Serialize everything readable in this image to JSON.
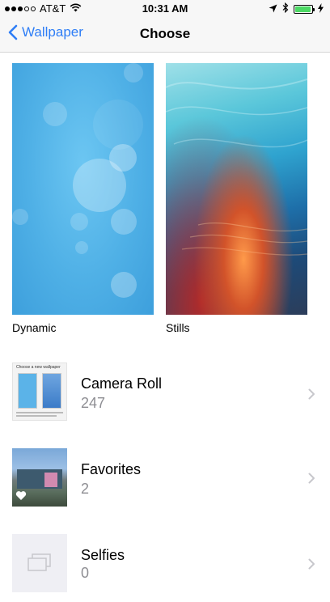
{
  "status_bar": {
    "carrier": "AT&T",
    "time": "10:31 AM",
    "signal_strength": 3,
    "signal_max": 5,
    "battery_level": 0.9,
    "battery_color": "#4cd964"
  },
  "nav": {
    "back_label": "Wallpaper",
    "title": "Choose",
    "accent_color": "#2f7ef6"
  },
  "categories": [
    {
      "label": "Dynamic"
    },
    {
      "label": "Stills"
    }
  ],
  "albums": [
    {
      "name": "Camera Roll",
      "count": "247"
    },
    {
      "name": "Favorites",
      "count": "2"
    },
    {
      "name": "Selfies",
      "count": "0"
    }
  ],
  "camera_thumb_text": "Choose a new wallpaper",
  "icons": {
    "back": "chevron-left-icon",
    "location": "location-arrow-icon",
    "bluetooth": "bluetooth-icon",
    "charging": "bolt-icon",
    "wifi": "wifi-icon",
    "row_disclosure": "chevron-right-icon",
    "favorite": "heart-icon",
    "empty_album": "stacked-photos-icon"
  }
}
